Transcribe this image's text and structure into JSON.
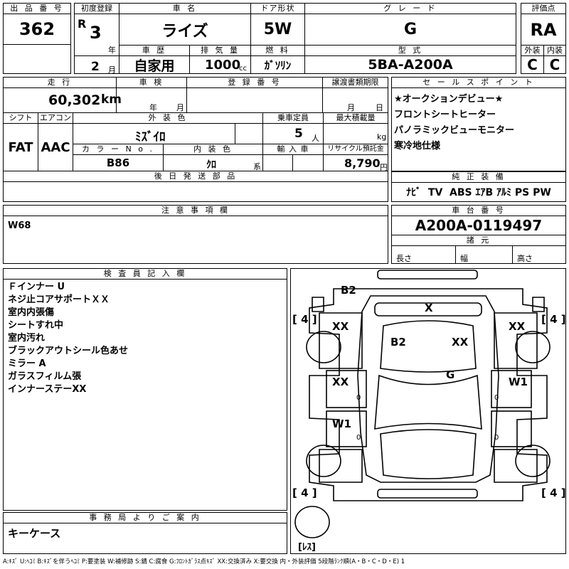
{
  "top": {
    "lot_label": "出 品 番 号",
    "lot_no": "362",
    "first_reg_label": "初度登録",
    "era": "R",
    "era_year": "3",
    "year_unit": "年",
    "month": "2",
    "month_unit": "月",
    "car_name_label": "車  名",
    "car_name": "ライズ",
    "door_label": "ドア形状",
    "door": "5W",
    "grade_label": "グ レ ー ド",
    "grade": "G",
    "score_label": "評価点",
    "score": "RA",
    "history_label": "車  歴",
    "history": "自家用",
    "displacement_label": "排 気 量",
    "displacement": "1000",
    "displacement_unit": "cc",
    "fuel_label": "燃  料",
    "fuel": "ｶﾞｿﾘﾝ",
    "model_label": "型  式",
    "model": "5BA-A200A",
    "ext_label": "外装",
    "ext": "C",
    "int_label": "内装",
    "int": "C"
  },
  "mid": {
    "mileage_label": "走  行",
    "mileage": "60,302",
    "mileage_unit": "km",
    "inspection_label": "車  検",
    "insp_year_unit": "年",
    "insp_month_unit": "月",
    "plate_label": "登 録 番 号",
    "transfer_label": "譲渡書類期限",
    "transfer_month_unit": "月",
    "transfer_day_unit": "日",
    "shift_label": "シフト",
    "shift": "FAT",
    "ac_label": "エアコン",
    "ac": "AAC",
    "ext_color_label": "外 装 色",
    "ext_color": "ﾐｽﾞｲﾛ",
    "capacity_label": "乗車定員",
    "capacity": "5",
    "capacity_unit": "人",
    "load_label": "最大積載量",
    "load_unit": "kg",
    "color_no_label": "カ ラ ー N o .",
    "color_no": "B86",
    "int_color_label": "内 装 色",
    "int_color": "ｸﾛ",
    "int_color_unit": "系",
    "import_label": "輸 入 車",
    "recycle_label": "リサイクル預託金",
    "recycle": "8,790",
    "recycle_unit": "円",
    "later_parts_label": "後 日 発 送 部 品"
  },
  "sales": {
    "label": "セ ー ル ス ポ イ ン ト",
    "points": [
      "★オークションデビュー★",
      "フロントシートヒーター",
      "パノラミックビューモニター",
      "寒冷地仕様"
    ]
  },
  "equipment": {
    "label": "純 正 装 備",
    "items": "ﾅﾋﾞ  TV  ABS ｴｱB ｱﾙﾐ PS PW"
  },
  "notes": {
    "label": "注 意 事 項 欄",
    "text": "W68"
  },
  "chassis": {
    "label": "車 台 番 号",
    "number": "A200A-0119497",
    "spec_label": "諸  元",
    "length_label": "長さ",
    "width_label": "幅",
    "height_label": "高さ"
  },
  "inspector": {
    "label": "検 査 員 記 入 欄",
    "lines": [
      "Ｆインナー U",
      "ネジ止コアサポートＸＸ",
      "室内内張傷",
      "シートすれ中",
      "室内汚れ",
      "ブラックアウトシール色あせ",
      "ミラー A",
      "ガラスフィルム張",
      "インナーステーXX"
    ]
  },
  "office": {
    "label": "事 務 局 よ り ご 案 内",
    "text": "キーケース"
  },
  "diagram": {
    "marks": {
      "rear": "B2",
      "roof_x": "X",
      "left_front_fender": "XX",
      "right_front_fender": "XX",
      "hood_left": "B2",
      "hood_right": "XX",
      "front_glass": "G",
      "left_door": "XX",
      "left_door_small": "0",
      "right_door": "W1",
      "right_door_small": "0",
      "left_rear_door": "W1",
      "left_rear_small": "0",
      "right_rear_small": "0"
    },
    "tire_tl": "[ 4 ]",
    "tire_tr": "[ 4 ]",
    "tire_bl": "[ 4 ]",
    "tire_br": "[ 4 ]",
    "spare": "[ﾚｽ]"
  },
  "legend": "A:ｷｽﾞ U:ﾍｺﾐ B:ｷｽﾞを伴うﾍｺﾐ P:要塗装 W:補修跡 S:錆 C:腐食 G:ﾌﾛﾝﾄｶﾞﾗｽ点ｷｽﾞ XX:交換済み X:要交換  内・外装評価 5段階ﾗﾝｸ順(A・B・C・D・E) 1"
}
